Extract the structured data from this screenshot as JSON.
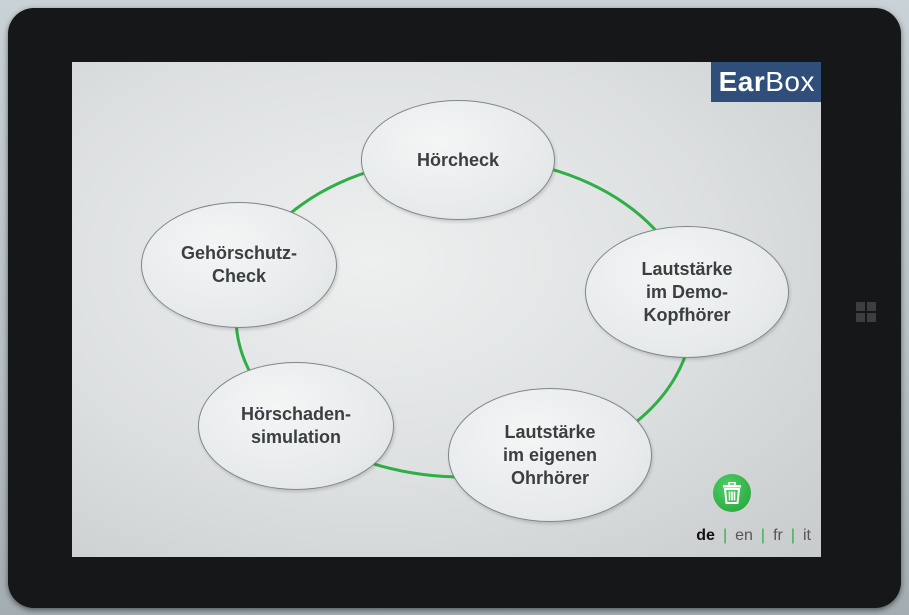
{
  "app": {
    "logo_bold": "Ear",
    "logo_light": "Box"
  },
  "menu": {
    "items": [
      {
        "id": "hoercheck",
        "label": "Hörcheck"
      },
      {
        "id": "demo",
        "label": "Lautstärke\nim Demo-\nKopfhörer"
      },
      {
        "id": "eigen",
        "label": "Lautstärke\nim eigenen\nOhrhörer"
      },
      {
        "id": "simulation",
        "label": "Hörschaden-\nsimulation"
      },
      {
        "id": "gehoerschutz",
        "label": "Gehörschutz-\nCheck"
      }
    ]
  },
  "languages": {
    "items": [
      "de",
      "en",
      "fr",
      "it"
    ],
    "active": "de"
  },
  "colors": {
    "accent": "#2fae45",
    "logo_bg": "#2f4f7a",
    "bezel": "#151719"
  },
  "icons": {
    "reset": "trash-icon",
    "os_key": "windows-logo-icon"
  }
}
